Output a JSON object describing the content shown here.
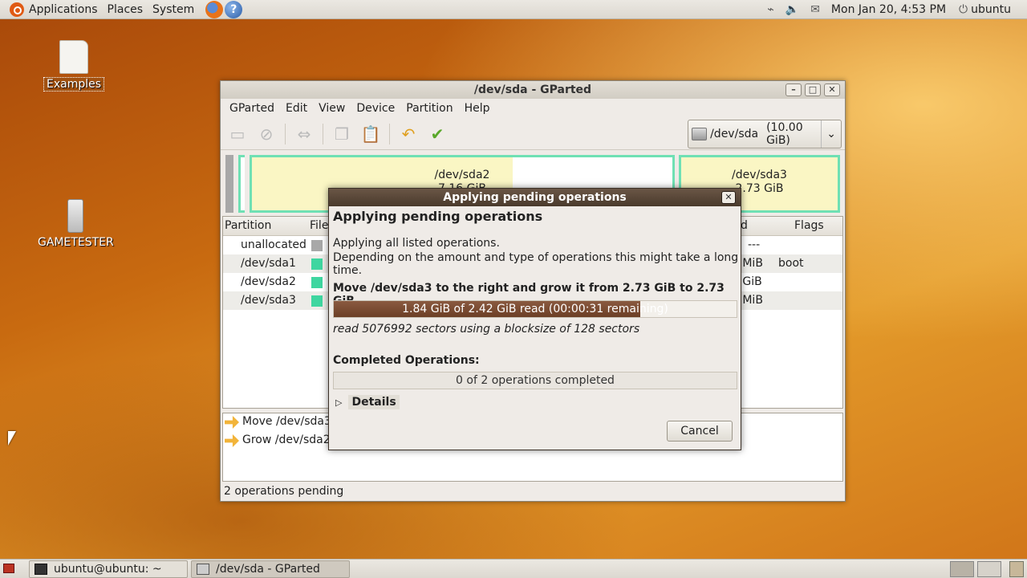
{
  "top_panel": {
    "menus": [
      "Applications",
      "Places",
      "System"
    ],
    "clock": "Mon Jan 20, 4:53 PM",
    "user": "ubuntu"
  },
  "desktop_icons": [
    {
      "label": "Examples",
      "icon": "document-icon"
    },
    {
      "label": "GAMETESTER",
      "icon": "usb-drive-icon"
    }
  ],
  "window": {
    "title": "/dev/sda - GParted",
    "menus": [
      "GParted",
      "Edit",
      "View",
      "Device",
      "Partition",
      "Help"
    ],
    "device": "/dev/sda",
    "device_size": "(10.00 GiB)",
    "partition_map": [
      {
        "name": "/dev/sda2",
        "size": "7.16 GiB"
      },
      {
        "name": "/dev/sda3",
        "size": "2.73 GiB"
      }
    ],
    "columns": [
      "Partition",
      "File",
      "d",
      "Flags"
    ],
    "rows": [
      {
        "partition": "unallocated",
        "swatch": "#a8a8a8",
        "used": "---",
        "flags": ""
      },
      {
        "partition": "/dev/sda1",
        "swatch": "#3fd6a0",
        "used": "1 MiB",
        "flags": "boot"
      },
      {
        "partition": "/dev/sda2",
        "swatch": "#3fd6a0",
        "used": "6 GiB",
        "flags": ""
      },
      {
        "partition": "/dev/sda3",
        "swatch": "#3fd6a0",
        "used": "1 MiB",
        "flags": ""
      }
    ],
    "operations": [
      "Move /dev/sda3 t",
      "Grow /dev/sda2 f"
    ],
    "status": "2 operations pending"
  },
  "dialog": {
    "title": "Applying pending operations",
    "heading": "Applying pending operations",
    "line1": "Applying all listed operations.",
    "line2": "Depending on the amount and type of operations this might take a long time.",
    "current_op": "Move /dev/sda3 to the right and grow it from 2.73 GiB to 2.73 GiB",
    "progress_text": "1.84 GiB of 2.42 GiB read (00:00:31 remaining)",
    "progress_fraction": 0.76,
    "detail": "read 5076992 sectors using a blocksize of 128 sectors",
    "completed_label": "Completed Operations:",
    "completed_text": "0 of 2 operations completed",
    "details_label": "Details",
    "cancel_label": "Cancel"
  },
  "taskbar": {
    "tasks": [
      "ubuntu@ubuntu: ~",
      "/dev/sda - GParted"
    ]
  }
}
